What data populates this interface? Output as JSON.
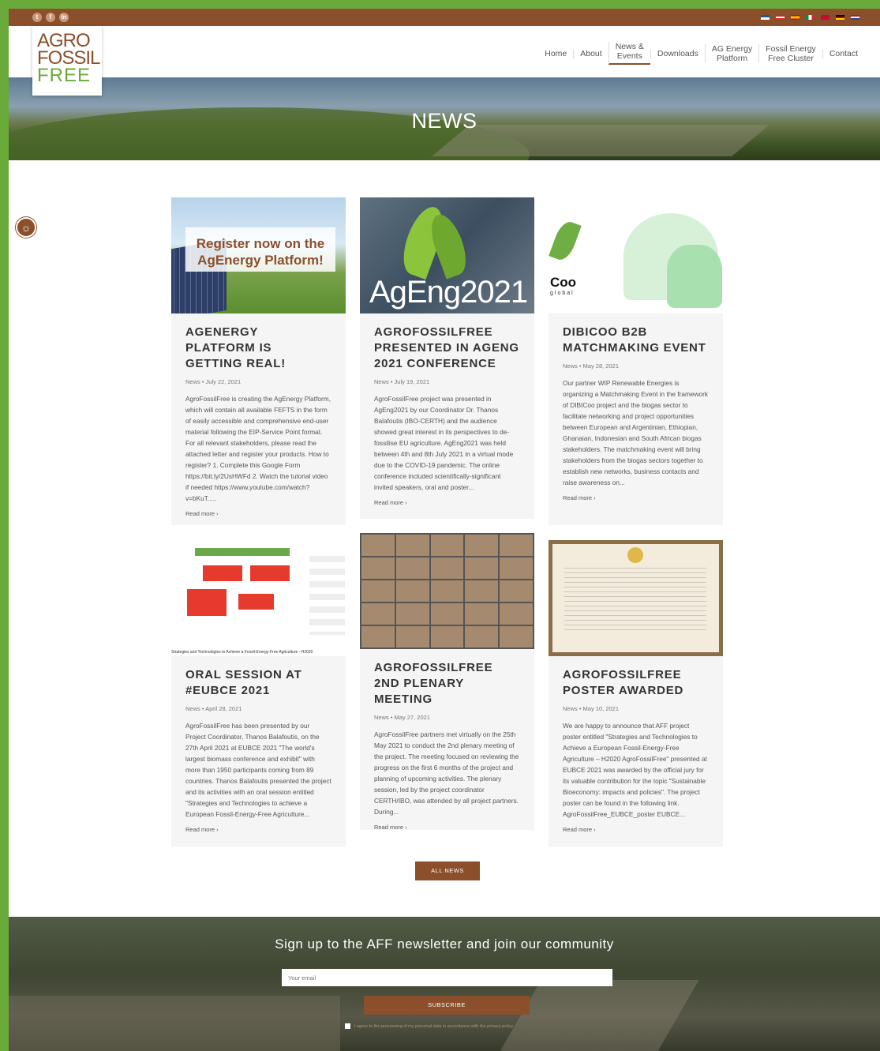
{
  "topbar": {
    "social": [
      "t",
      "f",
      "in"
    ],
    "flags": [
      {
        "name": "greek-flag",
        "colors": [
          "#1b56a0",
          "#fff"
        ]
      },
      {
        "name": "austrian-flag",
        "colors": [
          "#d52b1e",
          "#fff"
        ]
      },
      {
        "name": "spanish-flag",
        "colors": [
          "#c60b1e",
          "#ffc400"
        ]
      },
      {
        "name": "italian-flag",
        "colors": [
          "#009246",
          "#ce2b37"
        ]
      },
      {
        "name": "danish-flag",
        "colors": [
          "#c60c30",
          "#fff"
        ]
      },
      {
        "name": "german-flag",
        "colors": [
          "#000",
          "#ffce00"
        ]
      },
      {
        "name": "dutch-flag",
        "colors": [
          "#ae1c28",
          "#21468b"
        ]
      }
    ]
  },
  "logo": {
    "line1": "AGRO",
    "line2": "FOSSIL",
    "line3": "FREE"
  },
  "nav": [
    {
      "label": "Home",
      "active": false
    },
    {
      "label": "About",
      "active": false
    },
    {
      "label": "News &\nEvents",
      "active": true
    },
    {
      "label": "Downloads",
      "active": false
    },
    {
      "label": "AG Energy\nPlatform",
      "active": false
    },
    {
      "label": "Fossil Energy\nFree Cluster",
      "active": false
    },
    {
      "label": "Contact",
      "active": false
    }
  ],
  "hero": {
    "title": "NEWS"
  },
  "cards": [
    {
      "title": "AGENERGY PLATFORM IS GETTING REAL!",
      "meta": "News • July 22, 2021",
      "excerpt": "AgroFossilFree is creating the AgEnergy Platform, which will contain all available FEFTS in the form of easily accessible and comprehensive end-user material following the EIP-Service Point format. For all relevant stakeholders, please read the attached letter and register your products. How to register? 1. Complete this Google Form https://bit.ly/2UsHWFd 2. Watch the tutorial video if needed https://www.youtube.com/watch?v=bKuT.....",
      "more": "Read more ›",
      "thumb_text": "Register now on the AgEnergy Platform!"
    },
    {
      "title": "AGROFOSSILFREE PRESENTED IN AGENG 2021 CONFERENCE",
      "meta": "News • July 19, 2021",
      "excerpt": "AgroFossilFree project was presented in AgEng2021 by our Coordinator Dr. Thanos Balafoutis (IBO-CERTH) and the audience showed great interest in its perspectives to de-fossilise EU agriculture. AgEng2021 was held between 4th and 8th July 2021 in a virtual mode due to the COVID-19 pandemic. The online conference included scientifically-significant invited speakers, oral and poster...",
      "more": "Read more ›",
      "thumb_text": "AgEng2021"
    },
    {
      "title": "DIBICOO B2B MATCHMAKING EVENT",
      "meta": "News • May 28, 2021",
      "excerpt": "Our partner WIP Renewable Energies is organizing a Matchmaking Event in the framework of DIBICoo project and the biogas sector to facilitate networking and project opportunities between European and Argentinian, Ethiopian, Ghanaian, Indonesian and South African biogas stakeholders. The matchmaking event will bring stakeholders from the biogas sectors together to establish new networks, business contacts and raise awareness on...",
      "more": "Read more ›",
      "thumb_text": "Coo",
      "thumb_sub": "global"
    },
    {
      "title": "ORAL SESSION AT #EUBCE 2021",
      "meta": "News • April 28, 2021",
      "excerpt": "AgroFossilFree has been presented by our Project Coordinator, Thanos Balafoutis, on the 27th April 2021 at EUBCE 2021 \"The world's largest biomass conference and exhibit\" with more than 1950 participants coming from 89 countries. Thanos Balafoutis presented the project and its activities with an oral session entitled \"Strategies and Technologies to achieve a European Fossil-Energy-Free Agriculture...",
      "more": "Read more ›",
      "thumb_text": "Strategies and Technologies to Achieve a Fossil-Energy-Free Agriculture - H2020"
    },
    {
      "title": "AGROFOSSILFREE 2ND PLENARY MEETING",
      "meta": "News • May 27, 2021",
      "excerpt": "AgroFossilFree partners met virtually on the 25th May 2021 to conduct the 2nd plenary meeting of the project. The meeting focused on reviewing the progress on the first 6 months of the project and planning of upcoming activities. The plenary session, led by the project coordinator CERTH/IBO, was attended by all project partners. During...",
      "more": "Read more ›"
    },
    {
      "title": "AGROFOSSILFREE POSTER AWARDED",
      "meta": "News • May 10, 2021",
      "excerpt": "We are happy to announce that AFF project poster entitled \"Strategies and Technologies to Achieve a European Fossil-Energy-Free Agriculture – H2020 AgroFossilFree\" presented at EUBCE 2021 was awarded by the official jury for its valuable contribution for the topic \"Sustainable Bioeconomy: impacts and policies\". The project poster can be found in the following link. AgroFossilFree_EUBCE_poster EUBCE...",
      "more": "Read more ›"
    }
  ],
  "all_news": "ALL NEWS",
  "newsletter": {
    "title": "Sign up to the AFF newsletter and join our community",
    "placeholder": "Your email",
    "button": "SUBSCRIBE",
    "agree": "I agree to the processing of my personal data in accordance with the privacy policy"
  },
  "colors": {
    "brand": "#8b4f2b",
    "accent": "#6aaa3a"
  }
}
